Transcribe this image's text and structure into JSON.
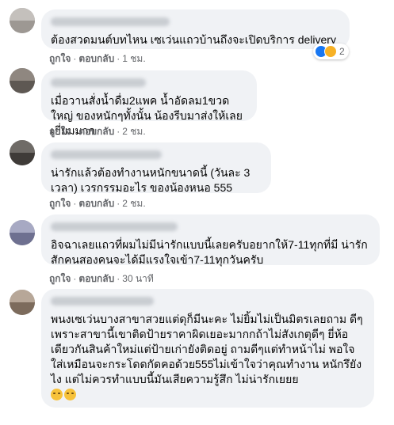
{
  "colors": {
    "bubble_bg": "#f0f2f5",
    "meta_text": "#65676b",
    "like_blue": "#1877f2",
    "haha_yellow": "#f7b125"
  },
  "comments": [
    {
      "text": "ต้องสวดมนต์บทไหน เซเว่นแถวบ้านถึงจะเปิดบริการ delivery",
      "like_label": "ถูกใจ",
      "reply_label": "ตอบกลับ",
      "time": "1 ชม.",
      "reactions": {
        "icons": [
          "like-icon",
          "haha-icon"
        ],
        "count": "2"
      }
    },
    {
      "text": "เมื่อวานสั่งน้ำดื่ม2แพค น้ำอัดลม1ขวดใหญ่ ของหนักๆทั้งนั้น น้องรีบมาส่งให้เลย เยี่ยมมาก",
      "like_label": "ถูกใจ",
      "reply_label": "ตอบกลับ",
      "time": "2 ชม."
    },
    {
      "text": "น่ารักแล้วต้องทำงานหนักขนาดนี้ (วันละ 3 เวลา) เวรกรรมอะไร ของน้องหนอ 555",
      "like_label": "ถูกใจ",
      "reply_label": "ตอบกลับ",
      "time": "2 ชม."
    },
    {
      "text": "อิจฉาเลยแถวที่ผมไม่มีน่ารักแบบนี้เลยครับอยากให้7-11ทุกที่มี น่ารักสักคนสองคนจะได้มีแรงใจเข้า7-11ทุกวันครับ",
      "like_label": "ถูกใจ",
      "reply_label": "ตอบกลับ",
      "time": "30 นาที"
    },
    {
      "text": "พนงเซเว่นบางสาขาสวยแต่ดุก็มีนะคะ ไม่ยิ้มไม่เป็นมิตรเลยถาม ดีๆเพราะสาขานี้เขาติดป้ายราคาผิดเยอะมากกถ้าไม่สังเกตุดีๆ ยี่ห้อเดียวกันสินค้าใหม่แต่ป้ายเก่ายังติดอยู่ ถามดีๆแต่ทำหน้าไม่ พอใจใส่เหมือนจะกระโดดกัดคอด้วย555ไม่เข้าใจว่าคุณทำงาน หนักรึยังไง แต่ไม่ควรทำแบบนี้มันเสียความรู้สึก ไม่น่ารักเยยย",
      "emojis": [
        "sad-face-icon",
        "sad-face-icon"
      ],
      "like_label": "",
      "reply_label": "",
      "time": ""
    }
  ]
}
